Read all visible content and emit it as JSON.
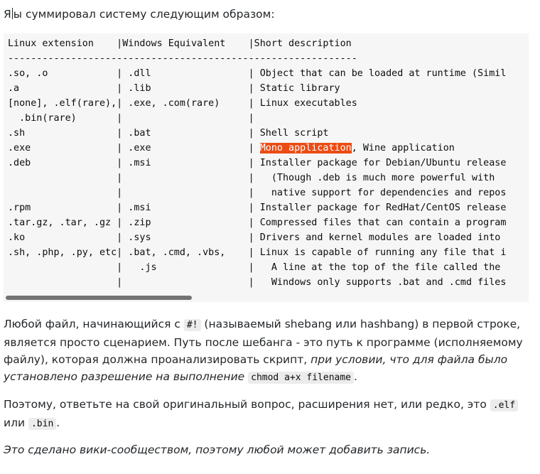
{
  "intro": {
    "before_caret": "Я",
    "after_caret": "ы суммировал систему следующим образом:"
  },
  "code": {
    "lines_before_highlight": [
      "Linux extension    |Windows Equivalent    |Short description",
      "-------------------------------------------------------------",
      ".so, .o            | .dll                 | Object that can be loaded at runtime (Simil",
      ".a                 | .lib                 | Static library",
      "[none], .elf(rare),| .exe, .com(rare)     | Linux executables",
      "  .bin(rare)       |                      |",
      ".sh                | .bat                 | Shell script"
    ],
    "highlight_line": {
      "prefix": ".exe               | .exe                 | ",
      "highlight": "Mono application",
      "suffix": ", Wine application"
    },
    "lines_after_highlight": [
      ".deb               | .msi                 | Installer package for Debian/Ubuntu release",
      "                   |                      |   (Though .deb is much more powerful with",
      "                   |                      |   native support for dependencies and repos",
      ".rpm               | .msi                 | Installer package for RedHat/CentOS release",
      ".tar.gz, .tar, .gz | .zip                 | Compressed files that can contain a program",
      ".ko                | .sys                 | Drivers and kernel modules are loaded into",
      ".sh, .php, .py, etc| .bat, .cmd, .vbs,    | Linux is capable of running any file that i",
      "                   |   .js                |   A line at the top of the file called the",
      "                   |                      |   Windows only supports .bat and .cmd files"
    ]
  },
  "para1": {
    "t1": "Любой файл, начинающийся с ",
    "code1": "#!",
    "t2": " (называемый shebang или hashbang) в первой строке, является просто сценарием. Путь после шебанга - это путь к программе (исполняемому файлу), которая должна проанализировать скрипт, ",
    "em1": "при условии, что для файла было установлено разрешение на выполнение",
    "t3": " ",
    "code2": "chmod a+x filename",
    "t4": "."
  },
  "para2": {
    "t1": "Поэтому, ответьте на свой оригинальный вопрос, расширения нет, или редко, это ",
    "code1": ".elf",
    "t2": " или ",
    "code2": ".bin",
    "t3": "."
  },
  "para3": {
    "em": "Это сделано вики-сообществом, поэтому любой может добавить запись."
  }
}
